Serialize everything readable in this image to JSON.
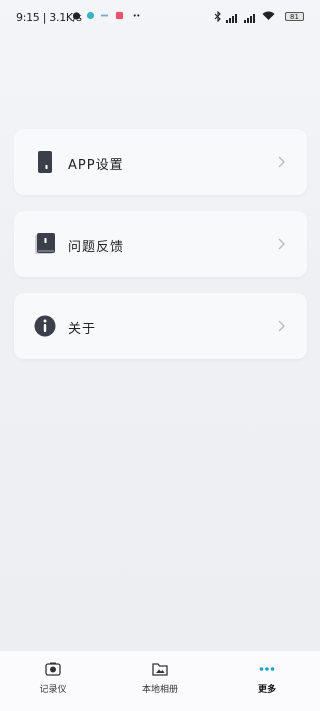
{
  "status_bar": {
    "time_speed": "9:15 | 3.1K/s",
    "battery": "81",
    "icons": [
      "alarm-icon",
      "app-icon",
      "app-icon",
      "app-icon",
      "more-dots-icon",
      "bluetooth-icon",
      "signal-icon",
      "signal-icon",
      "wifi-icon",
      "battery-icon"
    ]
  },
  "menu": {
    "items": [
      {
        "label": "APP设置",
        "icon": "phone-icon"
      },
      {
        "label": "问题反馈",
        "icon": "book-icon"
      },
      {
        "label": "关于",
        "icon": "info-icon"
      }
    ]
  },
  "tabbar": {
    "tabs": [
      {
        "label": "记录仪",
        "icon": "camera-icon"
      },
      {
        "label": "本地相册",
        "icon": "folder-image-icon"
      },
      {
        "label": "更多",
        "icon": "more-dots-icon"
      }
    ],
    "active_color": "#1aa3c9"
  },
  "colors": {
    "background": "#eef0f4",
    "card": "#f8f9fb",
    "icon_dark": "#3a3f4a"
  }
}
